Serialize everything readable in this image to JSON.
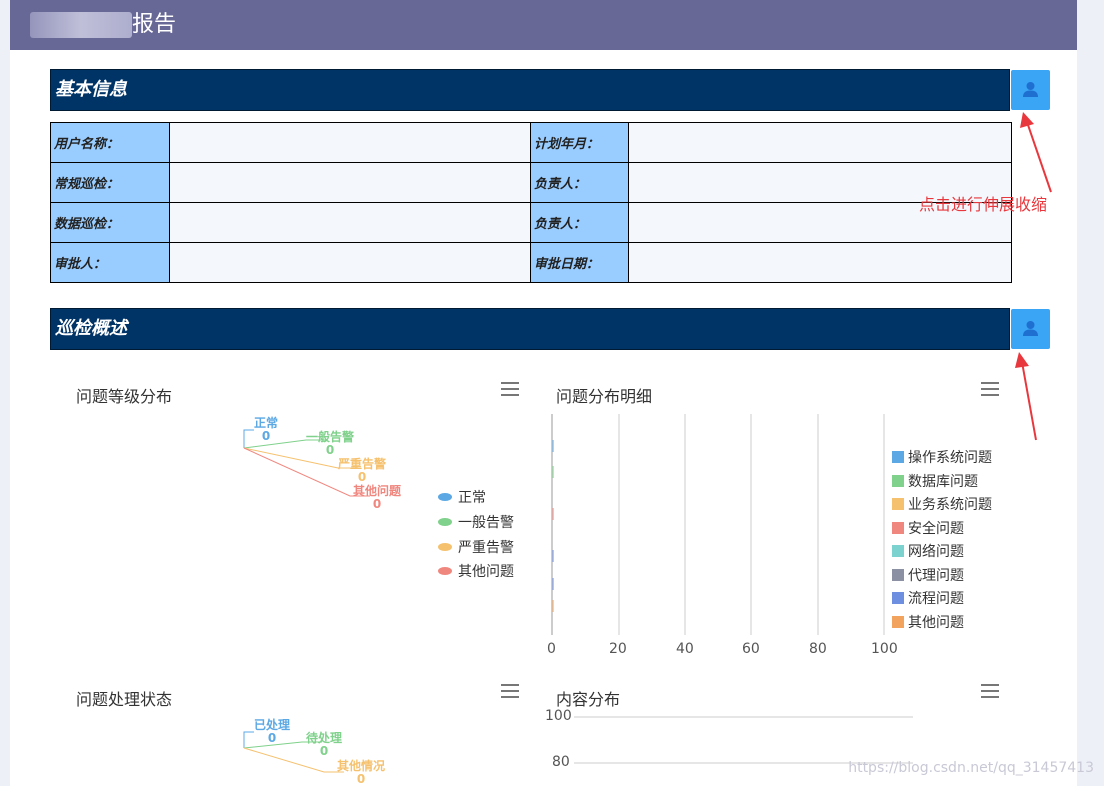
{
  "header": {
    "title": "报告"
  },
  "sections": {
    "basic": {
      "title": "基本信息"
    },
    "overview": {
      "title": "巡检概述"
    }
  },
  "info_table": {
    "rows": [
      {
        "left_label": "用户名称：",
        "right_label": "计划年月："
      },
      {
        "left_label": "常规巡检：",
        "right_label": "负责人："
      },
      {
        "left_label": "数据巡检：",
        "right_label": "负责人："
      },
      {
        "left_label": "审批人：",
        "right_label": "审批日期："
      }
    ]
  },
  "annotation": {
    "text": "点击进行伸展收缩",
    "color": "#e8383d"
  },
  "charts": {
    "level": {
      "title": "问题等级分布",
      "labels": [
        {
          "name": "正常",
          "value": "0",
          "color": "#5ba8e4"
        },
        {
          "name": "一般告警",
          "value": "0",
          "color": "#7fd18b"
        },
        {
          "name": "严重告警",
          "value": "0",
          "color": "#f5c16e"
        },
        {
          "name": "其他问题",
          "value": "0",
          "color": "#f0877f"
        }
      ],
      "legend": [
        "正常",
        "一般告警",
        "严重告警",
        "其他问题"
      ]
    },
    "detail": {
      "title": "问题分布明细",
      "ticks": [
        "0",
        "20",
        "40",
        "60",
        "80",
        "100"
      ],
      "legend": [
        {
          "name": "操作系统问题",
          "color": "#5ba8e4"
        },
        {
          "name": "数据库问题",
          "color": "#7fd18b"
        },
        {
          "name": "业务系统问题",
          "color": "#f5c16e"
        },
        {
          "name": "安全问题",
          "color": "#f0877f"
        },
        {
          "name": "网络问题",
          "color": "#7bd2cf"
        },
        {
          "name": "代理问题",
          "color": "#8c90a3"
        },
        {
          "name": "流程问题",
          "color": "#6e8ee0"
        },
        {
          "name": "其他问题",
          "color": "#f2a35e"
        }
      ]
    },
    "status": {
      "title": "问题处理状态",
      "labels": [
        {
          "name": "已处理",
          "value": "0",
          "color": "#5ba8e4"
        },
        {
          "name": "待处理",
          "value": "0",
          "color": "#7fd18b"
        },
        {
          "name": "其他情况",
          "value": "0",
          "color": "#f5c16e"
        }
      ]
    },
    "content": {
      "title": "内容分布",
      "ticks": [
        "100",
        "80"
      ]
    }
  },
  "watermark": "https://blog.csdn.net/qq_31457413"
}
